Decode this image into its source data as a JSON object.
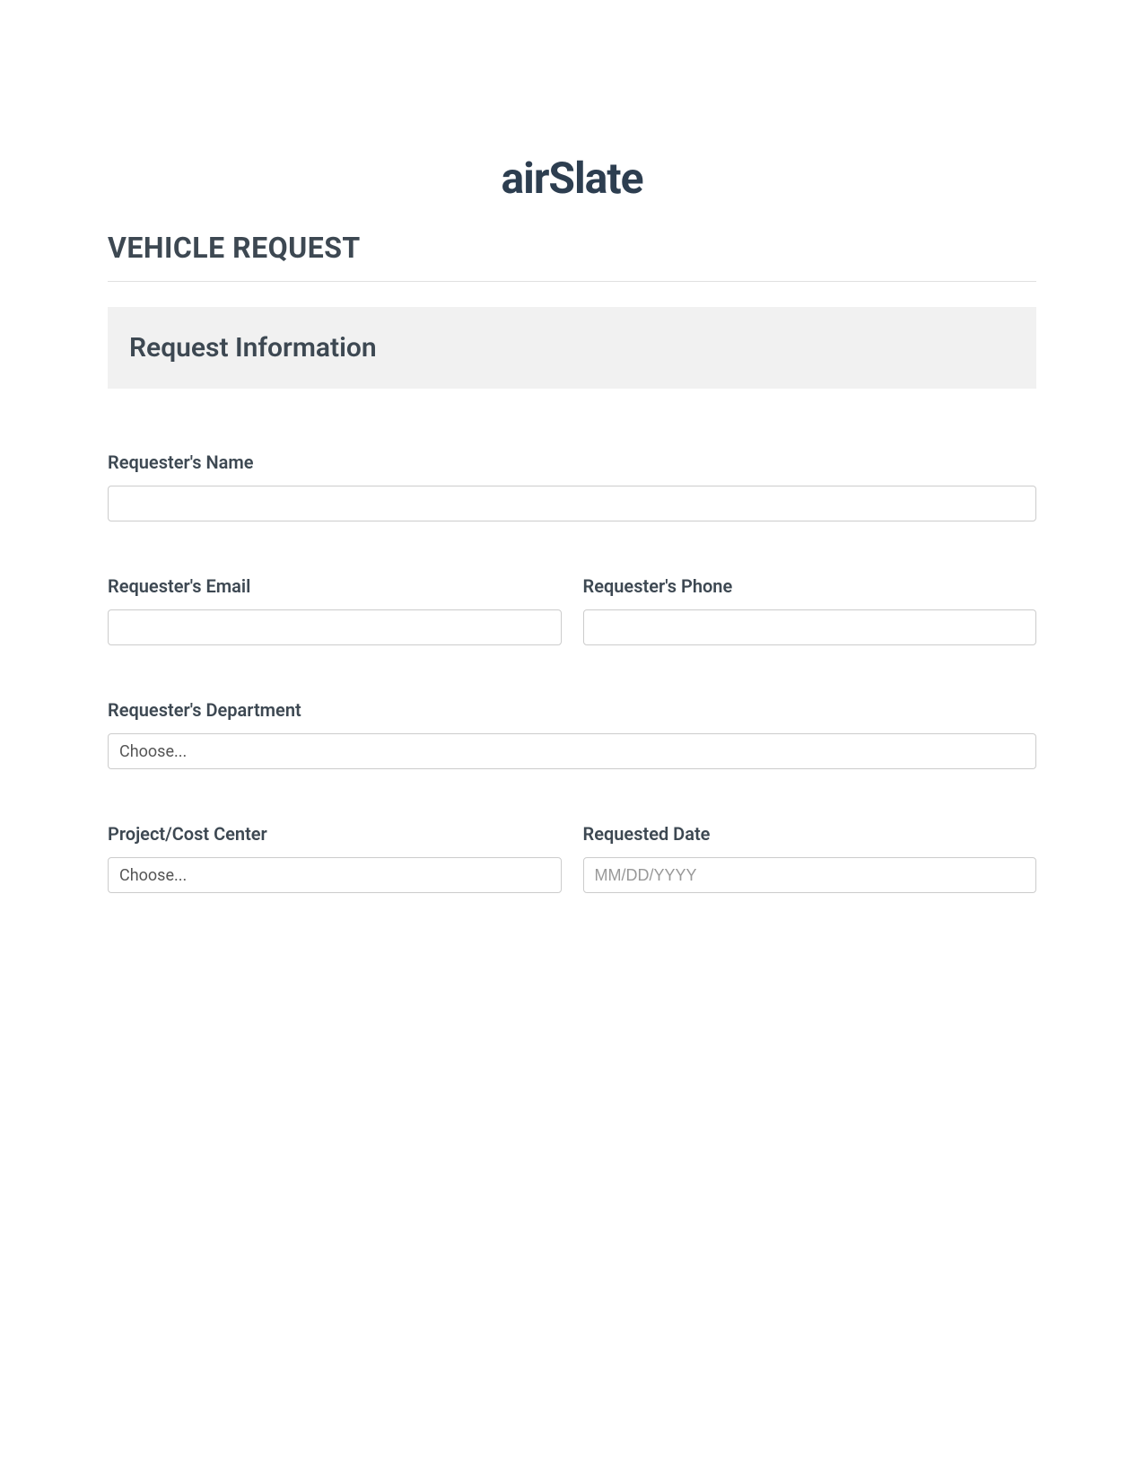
{
  "logo": {
    "prefix": "air",
    "suffix": "Slate"
  },
  "page_title": "VEHICLE REQUEST",
  "section": {
    "title": "Request Information"
  },
  "fields": {
    "requester_name": {
      "label": "Requester's Name",
      "value": ""
    },
    "requester_email": {
      "label": "Requester's Email",
      "value": ""
    },
    "requester_phone": {
      "label": "Requester's Phone",
      "value": ""
    },
    "requester_department": {
      "label": "Requester's Department",
      "placeholder": "Choose..."
    },
    "project_cost_center": {
      "label": "Project/Cost Center",
      "placeholder": "Choose..."
    },
    "requested_date": {
      "label": "Requested Date",
      "placeholder": "MM/DD/YYYY"
    }
  }
}
